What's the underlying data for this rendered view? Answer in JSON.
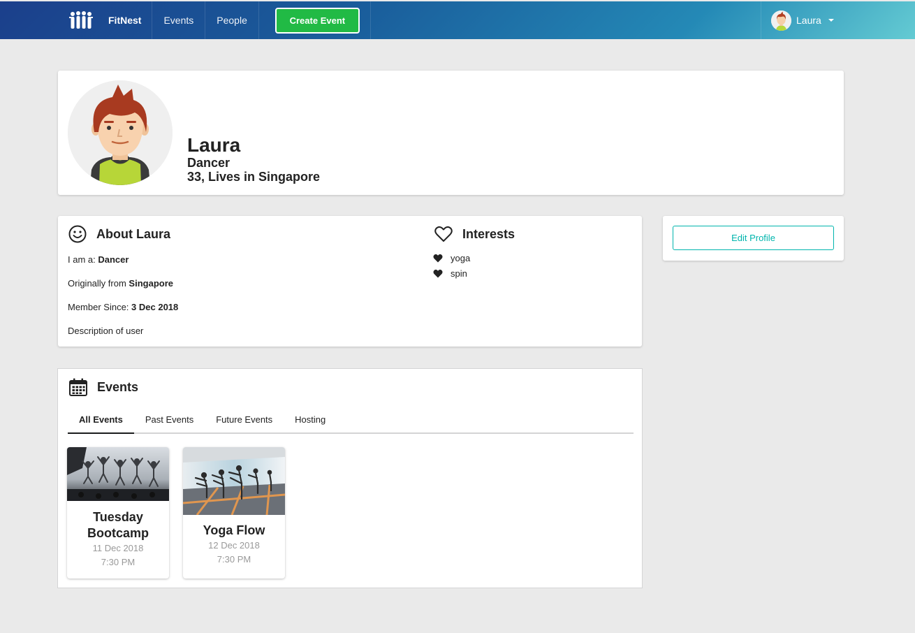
{
  "nav": {
    "brand": "FitNest",
    "items": [
      "Events",
      "People"
    ],
    "create_label": "Create Event",
    "user_name": "Laura"
  },
  "profile": {
    "name": "Laura",
    "occupation": "Dancer",
    "age_location": "33, Lives in Singapore"
  },
  "about": {
    "title": "About Laura",
    "iam_label": "I am a: ",
    "iam_value": "Dancer",
    "from_label": "Originally from ",
    "from_value": "Singapore",
    "since_label": "Member Since: ",
    "since_value": "3 Dec 2018",
    "description": "Description of user"
  },
  "interests": {
    "title": "Interests",
    "items": [
      "yoga",
      "spin"
    ]
  },
  "edit_profile_label": "Edit Profile",
  "events": {
    "title": "Events",
    "tabs": [
      "All Events",
      "Past Events",
      "Future Events",
      "Hosting"
    ],
    "active_tab": "All Events",
    "list": [
      {
        "title": "Tuesday Bootcamp",
        "date": "11 Dec 2018",
        "time": "7:30 PM"
      },
      {
        "title": "Yoga Flow",
        "date": "12 Dec 2018",
        "time": "7:30 PM"
      }
    ]
  },
  "icons": {
    "logo": "people-group-icon",
    "about": "smile-icon",
    "interests": "heart-outline-icon",
    "interest_item": "heart-icon",
    "events": "calendar-icon"
  },
  "colors": {
    "nav_gradient_start": "#1b3f8b",
    "nav_gradient_end": "#64cbd3",
    "create_button": "#21ba45",
    "edit_button": "#00b5ad"
  }
}
